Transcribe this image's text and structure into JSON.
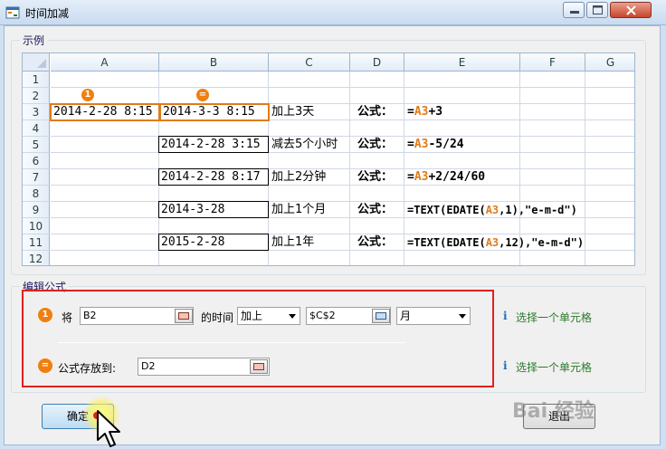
{
  "window": {
    "title": "时间加减"
  },
  "example": {
    "label": "示例",
    "columns": [
      "A",
      "B",
      "C",
      "D",
      "E",
      "F",
      "G"
    ],
    "rows": [
      "1",
      "2",
      "3",
      "4",
      "5",
      "6",
      "7",
      "8",
      "9",
      "10",
      "11",
      "12"
    ],
    "badge_a": "1",
    "badge_b": "=",
    "a3": "2014-2-28 8:15",
    "b3": "2014-3-3 8:15",
    "b5": "2014-2-28 3:15",
    "b7": "2014-2-28 8:17",
    "b9": "2014-3-28",
    "b11": "2015-2-28",
    "c3": "加上3天",
    "c5": "减去5个小时",
    "c7": "加上2分钟",
    "c9": "加上1个月",
    "c11": "加上1年",
    "d_label": "公式：",
    "f3": {
      "pre": "=",
      "ref": "A3",
      "post": "+3"
    },
    "f5": {
      "pre": "=",
      "ref": "A3",
      "post": "-5/24"
    },
    "f7": {
      "pre": "=",
      "ref": "A3",
      "post": "+2/24/60"
    },
    "f9": {
      "pre": "=TEXT(EDATE(",
      "ref": "A3",
      "post": ",1),\"e-m-d\")"
    },
    "f11": {
      "pre": "=TEXT(EDATE(",
      "ref": "A3",
      "post": ",12),\"e-m-d\")"
    }
  },
  "edit": {
    "label": "编辑公式",
    "badge_1": "1",
    "badge_2": "=",
    "jiang": "将",
    "source_value": "B2",
    "de_shijian": "的时间",
    "op_selected": "加上",
    "amount_value": "$C$2",
    "unit_selected": "月",
    "store_label": "公式存放到:",
    "target_value": "D2",
    "hint1": "选择一个单元格",
    "hint2": "选择一个单元格"
  },
  "buttons": {
    "ok": "确定",
    "exit": "退出"
  },
  "watermark": "Bai 经验"
}
